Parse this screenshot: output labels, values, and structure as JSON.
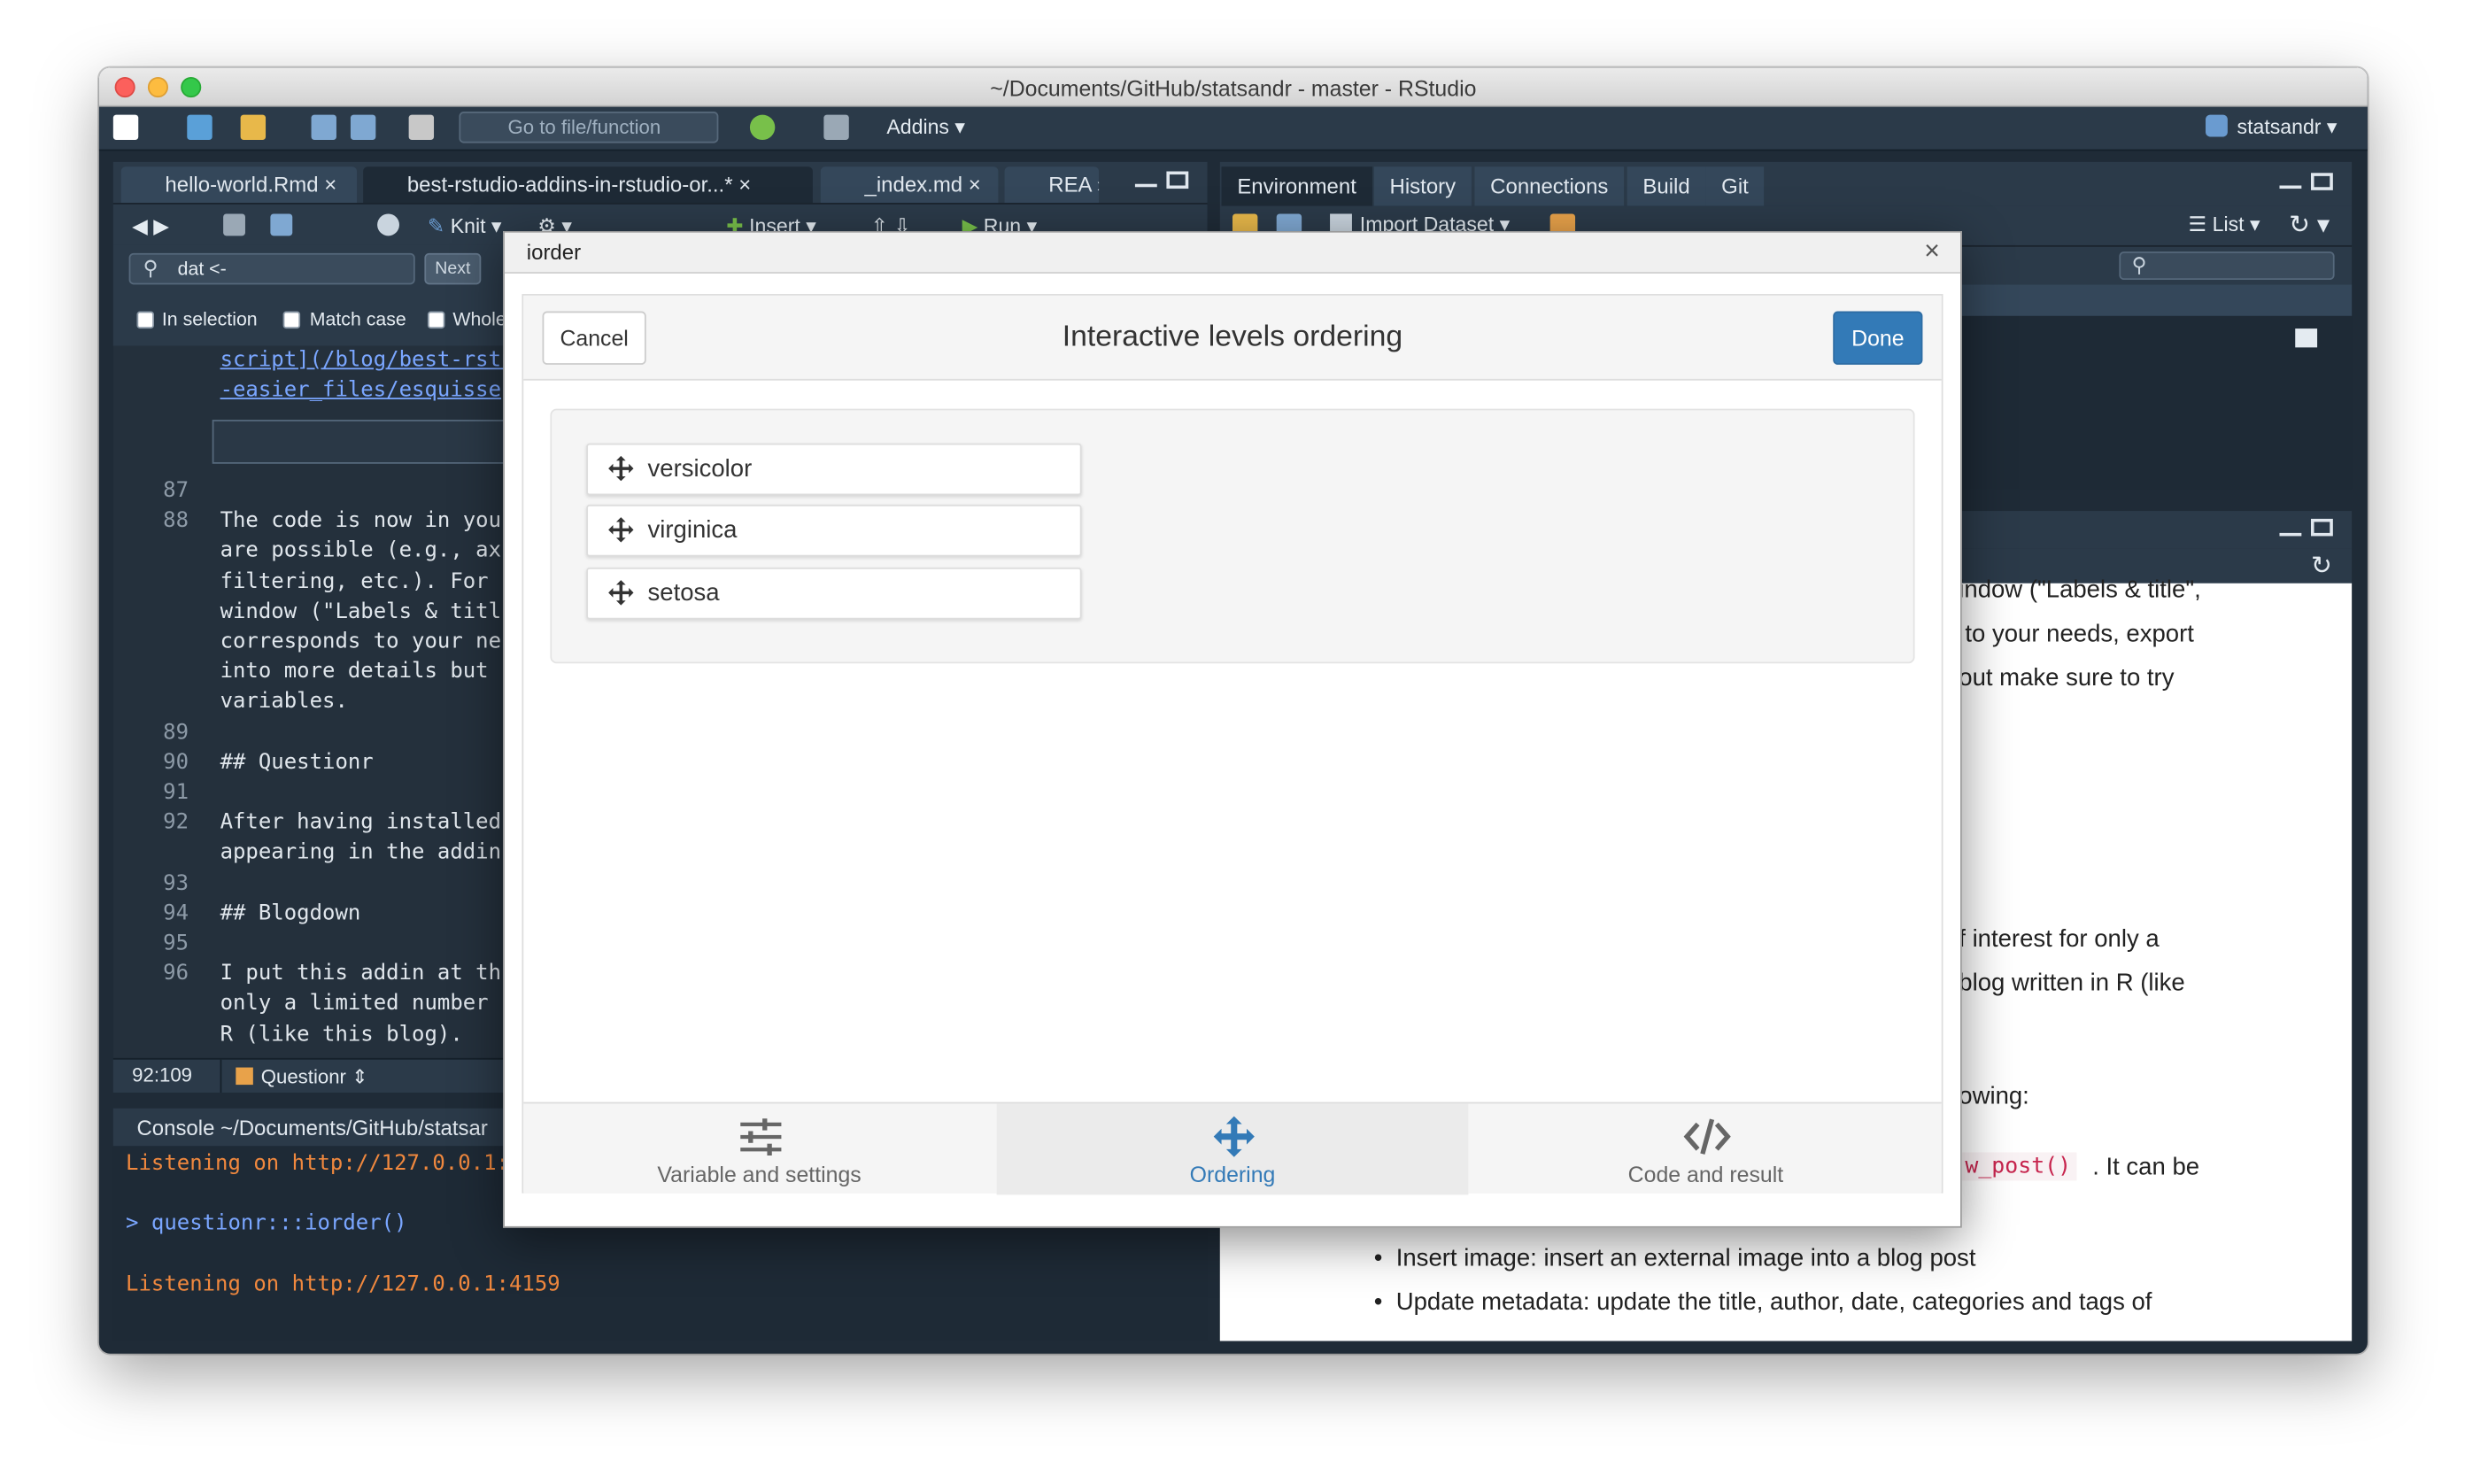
{
  "window": {
    "title": "~/Documents/GitHub/statsandr - master - RStudio"
  },
  "toolbar": {
    "goto_placeholder": "Go to file/function",
    "addins_label": "Addins",
    "user_label": "statsandr"
  },
  "editor": {
    "tabs": [
      {
        "label": "hello-world.Rmd"
      },
      {
        "label": "best-rstudio-addins-in-rstudio-or...*"
      },
      {
        "label": "_index.md"
      },
      {
        "label": "REA"
      }
    ],
    "toolbar": {
      "knit": "Knit",
      "insert": "Insert",
      "run": "Run"
    },
    "find": {
      "value": "dat <-",
      "next": "Next",
      "in_selection": "In selection",
      "match_case": "Match case",
      "whole": "Whole"
    },
    "code_top": [
      "script](/blog/best-rstu",
      "-easier_files/esquisse"
    ],
    "lines": [
      {
        "num": "87",
        "text": ""
      },
      {
        "num": "88",
        "text": "The code is now in you"
      },
      {
        "num": "",
        "text": "are possible (e.g., ax"
      },
      {
        "num": "",
        "text": "filtering, etc.). For "
      },
      {
        "num": "",
        "text": "window (\"Labels & titl"
      },
      {
        "num": "",
        "text": "corresponds to your ne"
      },
      {
        "num": "",
        "text": "into more details but "
      },
      {
        "num": "",
        "text": "variables."
      },
      {
        "num": "89",
        "text": ""
      },
      {
        "num": "90",
        "text": "## Questionr"
      },
      {
        "num": "91",
        "text": ""
      },
      {
        "num": "92",
        "text": "After having installed"
      },
      {
        "num": "",
        "text": "appearing in the addin"
      },
      {
        "num": "93",
        "text": ""
      },
      {
        "num": "94",
        "text": "## Blogdown"
      },
      {
        "num": "95",
        "text": ""
      },
      {
        "num": "96",
        "text": "I put this addin at th"
      },
      {
        "num": "",
        "text": "only a limited number "
      },
      {
        "num": "",
        "text": "R (like this blog)."
      }
    ],
    "status": {
      "position": "92:109",
      "section": "Questionr"
    }
  },
  "console": {
    "title": "Console ~/Documents/GitHub/statsar",
    "lines": [
      {
        "text": "Listening on http://127.0.0.1:",
        "color": "#f0883e"
      },
      {
        "text": "",
        "color": "#e0e6ec"
      },
      {
        "text": "> questionr:::iorder()",
        "color": "#7aa6ff"
      },
      {
        "text": "",
        "color": "#e0e6ec"
      },
      {
        "text": "Listening on http://127.0.0.1:4159",
        "color": "#f0883e"
      }
    ]
  },
  "right_pane": {
    "tabs": [
      "Environment",
      "History",
      "Connections",
      "Build",
      "Git"
    ],
    "import_dataset": "Import Dataset",
    "list_label": "List",
    "doc_lines": [
      "indow (\"Labels & title\",",
      "to your needs, export",
      "out make sure to try",
      "f interest for only a",
      "blog written in R (like",
      "owing:",
      ". It can be"
    ],
    "code_span": "w_post()",
    "bullets": [
      "Insert image: insert an external image into a blog post",
      "Update metadata: update the title, author, date, categories and tags of"
    ]
  },
  "modal": {
    "window_title": "iorder",
    "title": "Interactive levels ordering",
    "cancel_label": "Cancel",
    "done_label": "Done",
    "levels": [
      "versicolor",
      "virginica",
      "setosa"
    ],
    "tabs": [
      {
        "label": "Variable and settings",
        "icon": "sliders-icon"
      },
      {
        "label": "Ordering",
        "icon": "arrows-move-icon"
      },
      {
        "label": "Code and result",
        "icon": "code-icon"
      }
    ],
    "active_tab": "Ordering",
    "colors": {
      "primary": "#337ab7",
      "tab_inactive": "#666666"
    }
  }
}
